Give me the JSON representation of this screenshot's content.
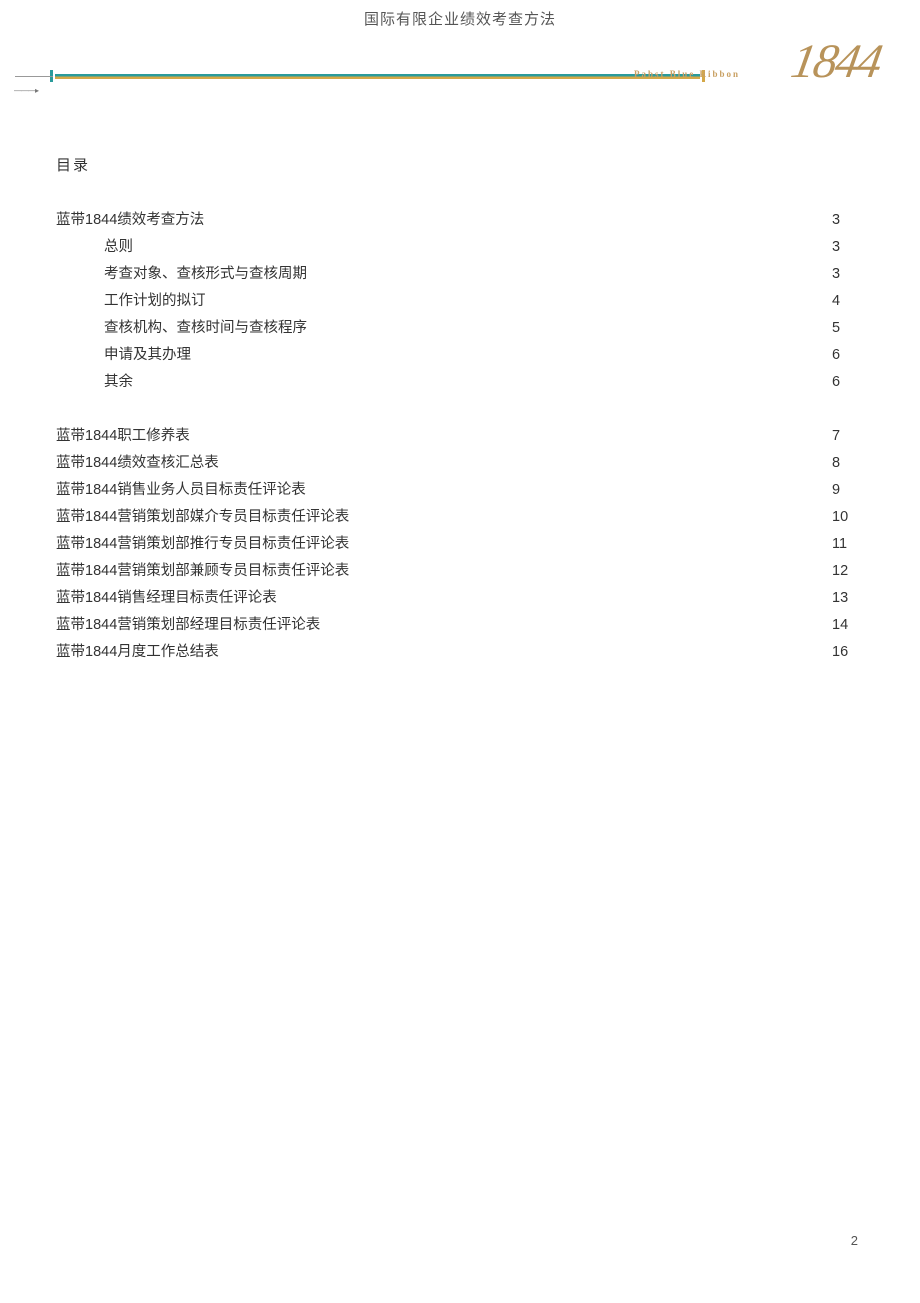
{
  "header": {
    "title": "国际有限企业绩效考查方法",
    "brand_text": "Pabst Blue Ribbon",
    "brand_year": "1844"
  },
  "toc": {
    "heading": "目录",
    "section1": {
      "title": "蓝带1844绩效考查方法",
      "page": "3",
      "items": [
        {
          "title": "总则",
          "page": "3"
        },
        {
          "title": "考查对象、查核形式与查核周期",
          "page": "3"
        },
        {
          "title": "工作计划的拟订",
          "page": "4"
        },
        {
          "title": "查核机构、查核时间与查核程序",
          "page": "5"
        },
        {
          "title": "申请及其办理",
          "page": "6"
        },
        {
          "title": "其余",
          "page": "6"
        }
      ]
    },
    "section2": [
      {
        "title": "蓝带1844职工修养表",
        "page": "7"
      },
      {
        "title": "蓝带1844绩效查核汇总表",
        "page": "8"
      },
      {
        "title": "蓝带1844销售业务人员目标责任评论表",
        "page": "9"
      },
      {
        "title": "蓝带1844营销策划部媒介专员目标责任评论表",
        "page": "10"
      },
      {
        "title": "蓝带1844营销策划部推行专员目标责任评论表",
        "page": "11"
      },
      {
        "title": "蓝带1844营销策划部兼顾专员目标责任评论表",
        "page": "12"
      },
      {
        "title": "蓝带1844销售经理目标责任评论表",
        "page": "13"
      },
      {
        "title": "蓝带1844营销策划部经理目标责任评论表",
        "page": "14"
      },
      {
        "title": "蓝带1844月度工作总结表",
        "page": "16"
      }
    ]
  },
  "footer": {
    "page_number": "2"
  }
}
